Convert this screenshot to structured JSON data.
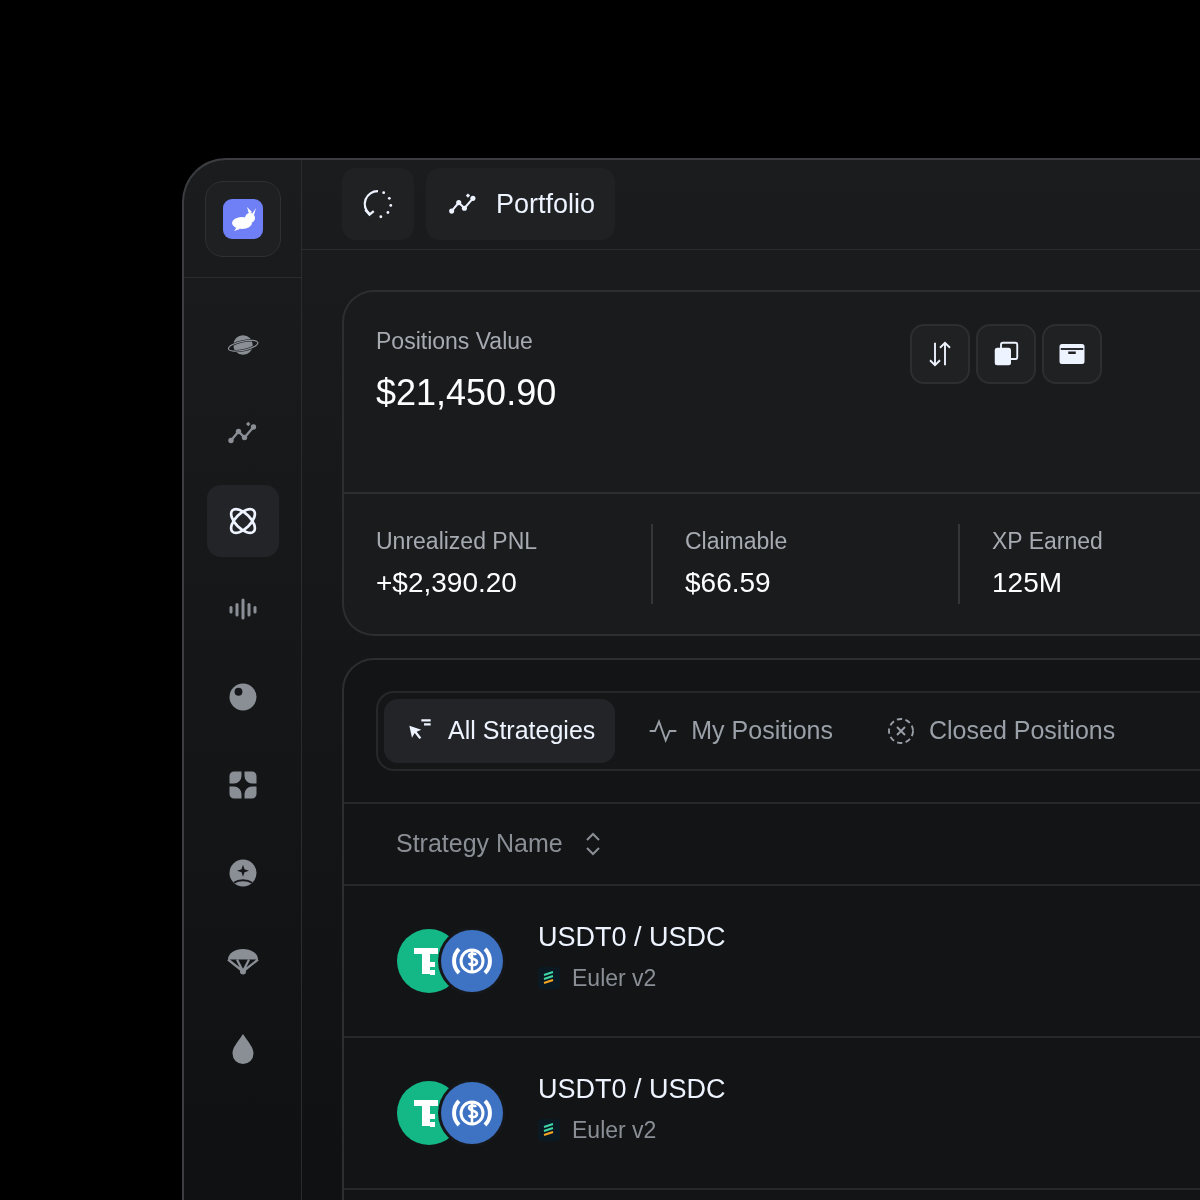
{
  "sidebar": {
    "items": [
      {
        "kind": "planet",
        "selected": false
      },
      {
        "kind": "chart",
        "selected": false
      },
      {
        "kind": "atom",
        "selected": true
      },
      {
        "kind": "bars",
        "selected": false
      },
      {
        "kind": "ball",
        "selected": false
      },
      {
        "kind": "squares",
        "selected": false
      },
      {
        "kind": "user",
        "selected": false
      },
      {
        "kind": "parachute",
        "selected": false
      },
      {
        "kind": "drop",
        "selected": false
      }
    ]
  },
  "topbar": {
    "page_title": "Portfolio"
  },
  "summary": {
    "label": "Positions Value",
    "value": "$21,450.90",
    "stats": [
      {
        "label": "Unrealized PNL",
        "value": "+$2,390.20"
      },
      {
        "label": "Claimable",
        "value": "$66.59"
      },
      {
        "label": "XP Earned",
        "value": "125M"
      }
    ]
  },
  "tabs": [
    {
      "label": "All Strategies",
      "kind": "filter",
      "selected": true
    },
    {
      "label": "My Positions",
      "kind": "pulse",
      "selected": false
    },
    {
      "label": "Closed Positions",
      "kind": "closed",
      "selected": false
    }
  ],
  "table": {
    "columns": [
      "Strategy Name"
    ],
    "rows": [
      {
        "pair": "USDT0 / USDC",
        "protocol": "Euler v2"
      },
      {
        "pair": "USDT0 / USDC",
        "protocol": "Euler v2"
      }
    ]
  }
}
